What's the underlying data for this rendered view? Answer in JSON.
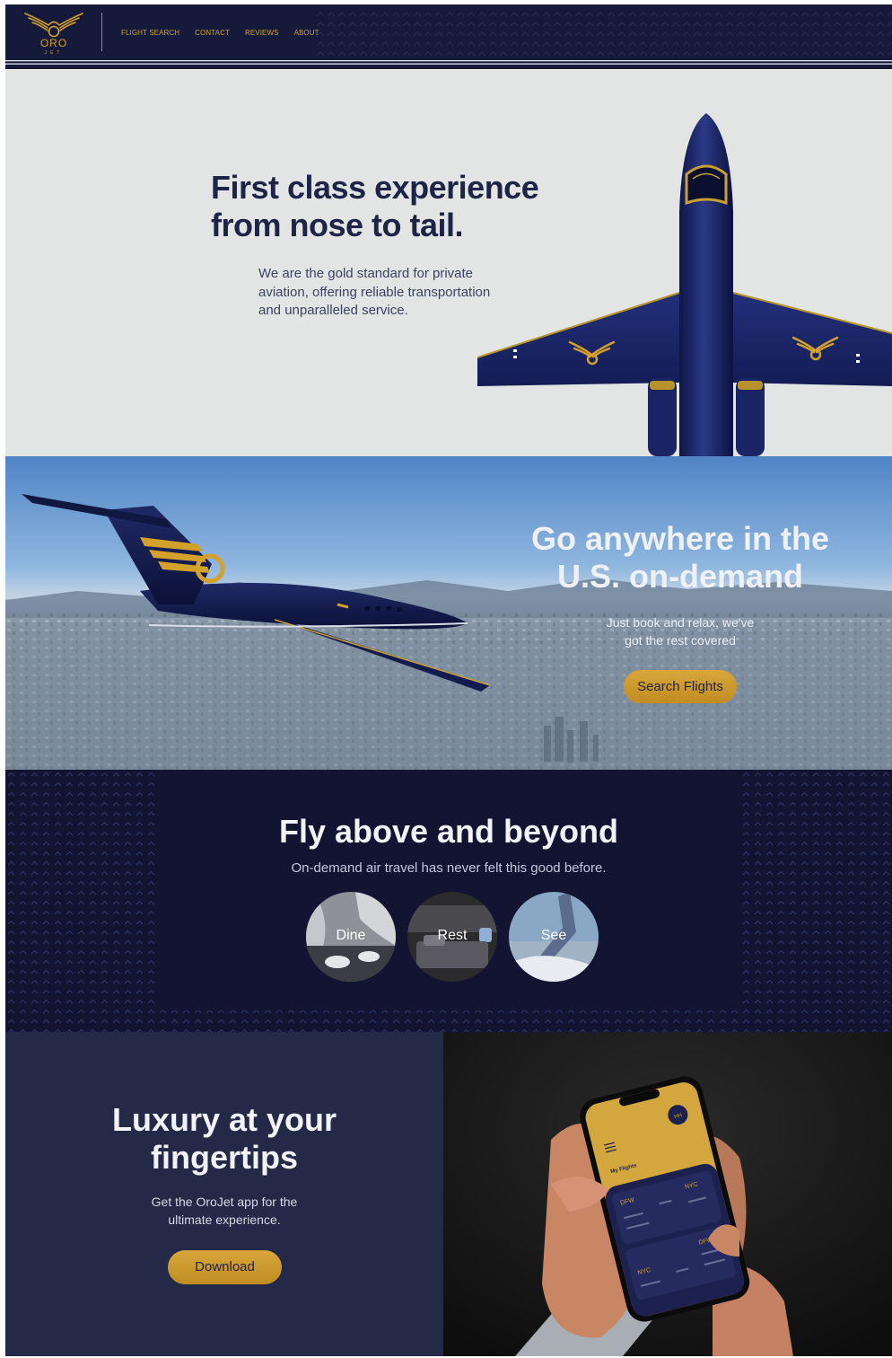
{
  "brand": {
    "name": "ORO",
    "sub": "JET",
    "gold": "#d4a12a",
    "navy": "#161a3a"
  },
  "nav": {
    "links": [
      "FLIGHT SEARCH",
      "CONTACT",
      "REVIEWS",
      "ABOUT"
    ]
  },
  "hero": {
    "title_line1": "First class experience",
    "title_line2": "from nose to tail.",
    "subtitle_line1": "We are the gold standard for private",
    "subtitle_line2": "aviation, offering reliable transportation",
    "subtitle_line3": "and unparalleled service."
  },
  "go_anywhere": {
    "title_line1": "Go anywhere in the",
    "title_line2": "U.S. on-demand",
    "subtitle_line1": "Just book and relax, we've",
    "subtitle_line2": "got the rest covered",
    "button": "Search Flights"
  },
  "fly_above": {
    "title": "Fly above and beyond",
    "subtitle": "On-demand air travel has never felt this good before.",
    "circles": [
      "Dine",
      "Rest",
      "See"
    ]
  },
  "luxury": {
    "title_line1": "Luxury at your",
    "title_line2": "fingertips",
    "subtitle_line1": "Get the OroJet app for the",
    "subtitle_line2": "ultimate experience.",
    "button": "Download"
  },
  "phone_app": {
    "avatar": "HH",
    "heading": "My Flights",
    "flight1_from": "DFW",
    "flight1_to": "NYC",
    "flight2_from": "NYC",
    "flight2_to": "DFW"
  }
}
